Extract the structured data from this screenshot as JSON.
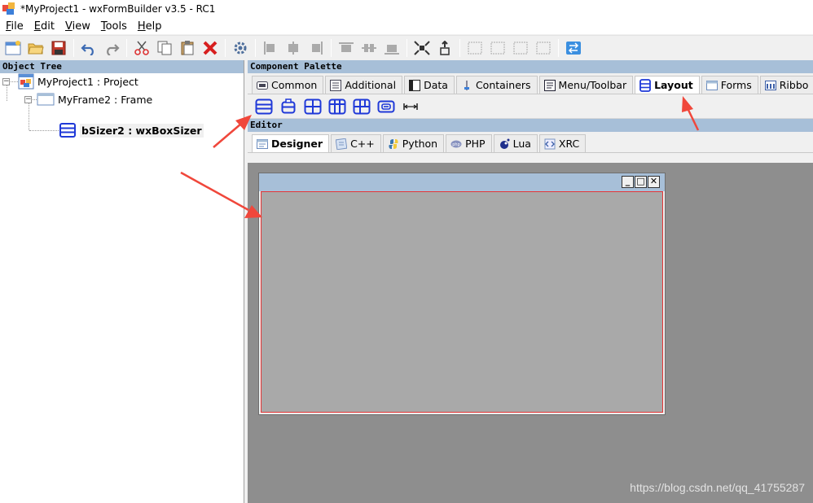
{
  "window": {
    "title": "*MyProject1 - wxFormBuilder v3.5 - RC1"
  },
  "menu": [
    {
      "underline": "F",
      "rest": "ile"
    },
    {
      "underline": "E",
      "rest": "dit"
    },
    {
      "underline": "V",
      "rest": "iew"
    },
    {
      "underline": "T",
      "rest": "ools"
    },
    {
      "underline": "H",
      "rest": "elp"
    }
  ],
  "toolbar_icons": [
    "new-project-icon",
    "open-project-icon",
    "save-icon",
    "undo-icon",
    "redo-icon",
    "cut-icon",
    "copy-icon",
    "paste-icon",
    "delete-icon",
    "generate-code-icon",
    "align-left-icon",
    "align-center-icon",
    "align-right-icon",
    "align-top-icon",
    "align-middle-icon",
    "align-bottom-icon",
    "expand-icon",
    "stretch-icon",
    "border-left-icon",
    "border-right-icon",
    "border-top-icon",
    "border-bottom-icon",
    "swap-orientation-icon"
  ],
  "object_tree": {
    "caption": "Object Tree",
    "nodes": [
      {
        "label": "MyProject1 : Project"
      },
      {
        "label": "MyFrame2 : Frame"
      },
      {
        "label": "bSizer2 : wxBoxSizer"
      }
    ]
  },
  "palette": {
    "caption": "Component Palette",
    "tabs": [
      {
        "label": "Common"
      },
      {
        "label": "Additional"
      },
      {
        "label": "Data"
      },
      {
        "label": "Containers"
      },
      {
        "label": "Menu/Toolbar"
      },
      {
        "label": "Layout"
      },
      {
        "label": "Forms"
      },
      {
        "label": "Ribbo"
      }
    ],
    "active_tab": "Layout",
    "tools": [
      "wxBoxSizer",
      "wxWrapSizer",
      "wxStaticBoxSizer",
      "wxGridSizer",
      "wxFlexGridSizer",
      "wxGridBagSizer",
      "spacer"
    ]
  },
  "editor": {
    "caption": "Editor",
    "tabs": [
      {
        "label": "Designer"
      },
      {
        "label": "C++"
      },
      {
        "label": "Python"
      },
      {
        "label": "PHP"
      },
      {
        "label": "Lua"
      },
      {
        "label": "XRC"
      }
    ],
    "active_tab": "Designer",
    "frame_buttons": {
      "minimize": "_",
      "maximize": "□",
      "close": "✕"
    }
  },
  "watermark": "https://blog.csdn.net/qq_41755287",
  "colors": {
    "caption": "#a7bfd8",
    "accent_blue": "#1f39d8",
    "arrow": "#f0473b",
    "sizer_border": "#e53535"
  }
}
